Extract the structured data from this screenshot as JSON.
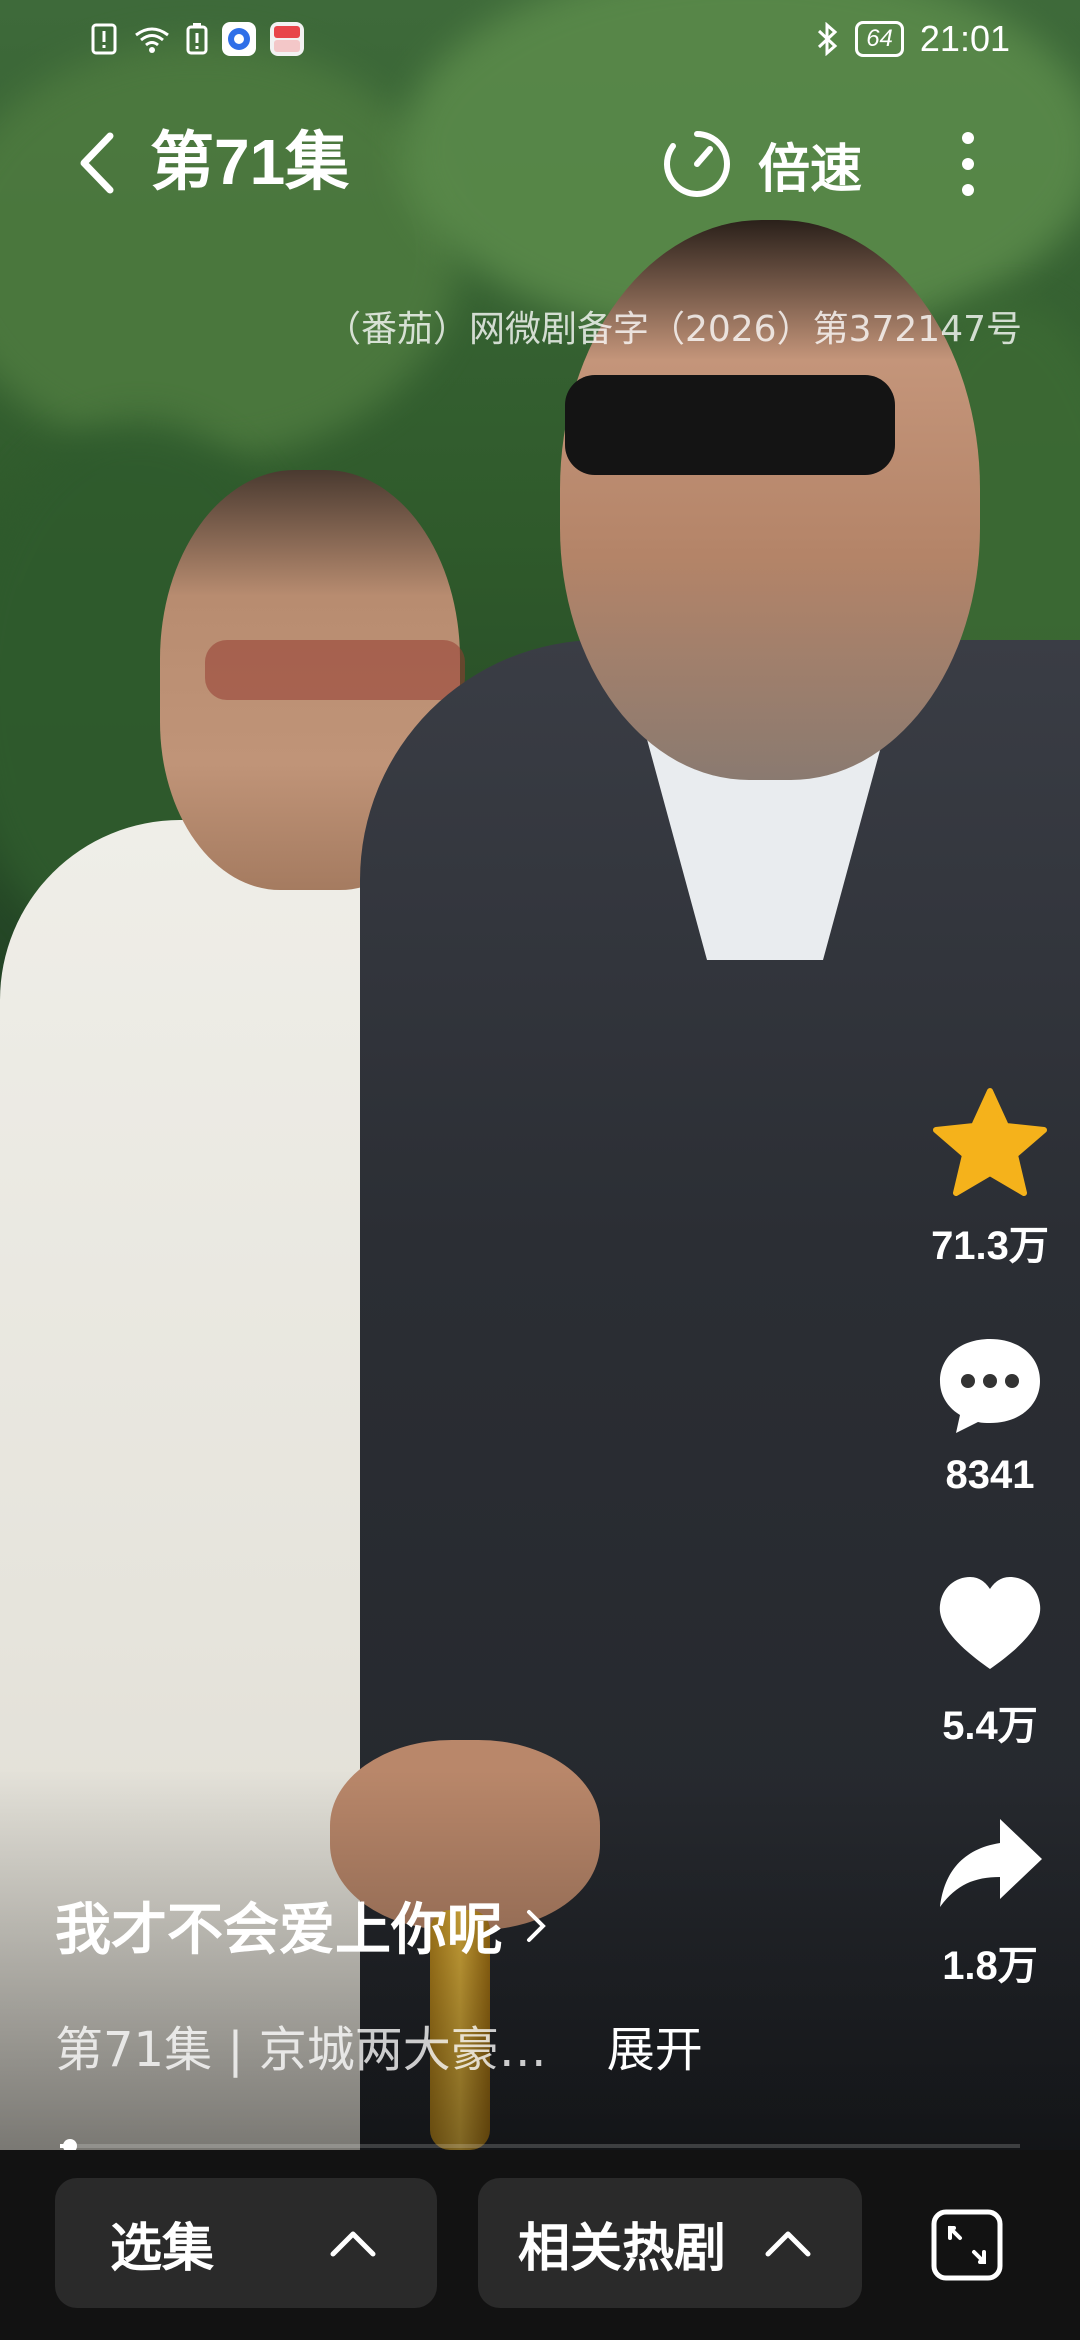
{
  "status_bar": {
    "time": "21:01",
    "battery": "64",
    "left_icons": [
      "sim-alert-icon",
      "wifi-icon",
      "battery-saver-icon",
      "app-notification-icon",
      "app-notification-icon-2"
    ],
    "right_icons": [
      "bluetooth-icon",
      "battery-icon"
    ]
  },
  "header": {
    "episode_title": "第71集",
    "speed_label": "倍速"
  },
  "license_text": "（番茄）网微剧备字（2026）第372147号",
  "actions": {
    "favorite_count": "71.3万",
    "comment_count": "8341",
    "like_count": "5.4万",
    "share_count": "1.8万"
  },
  "caption": {
    "drama_title": "我才不会爱上你呢",
    "description": "第71集 | 京城两大豪…",
    "expand_label": "展开"
  },
  "playback": {
    "progress": 0.01
  },
  "bottom_bar": {
    "episodes_label": "选集",
    "related_label": "相关热剧"
  },
  "colors": {
    "favorite_star": "#F5B21B",
    "bottom_bg": "#121212",
    "pill_bg": "#2A2A2A"
  }
}
